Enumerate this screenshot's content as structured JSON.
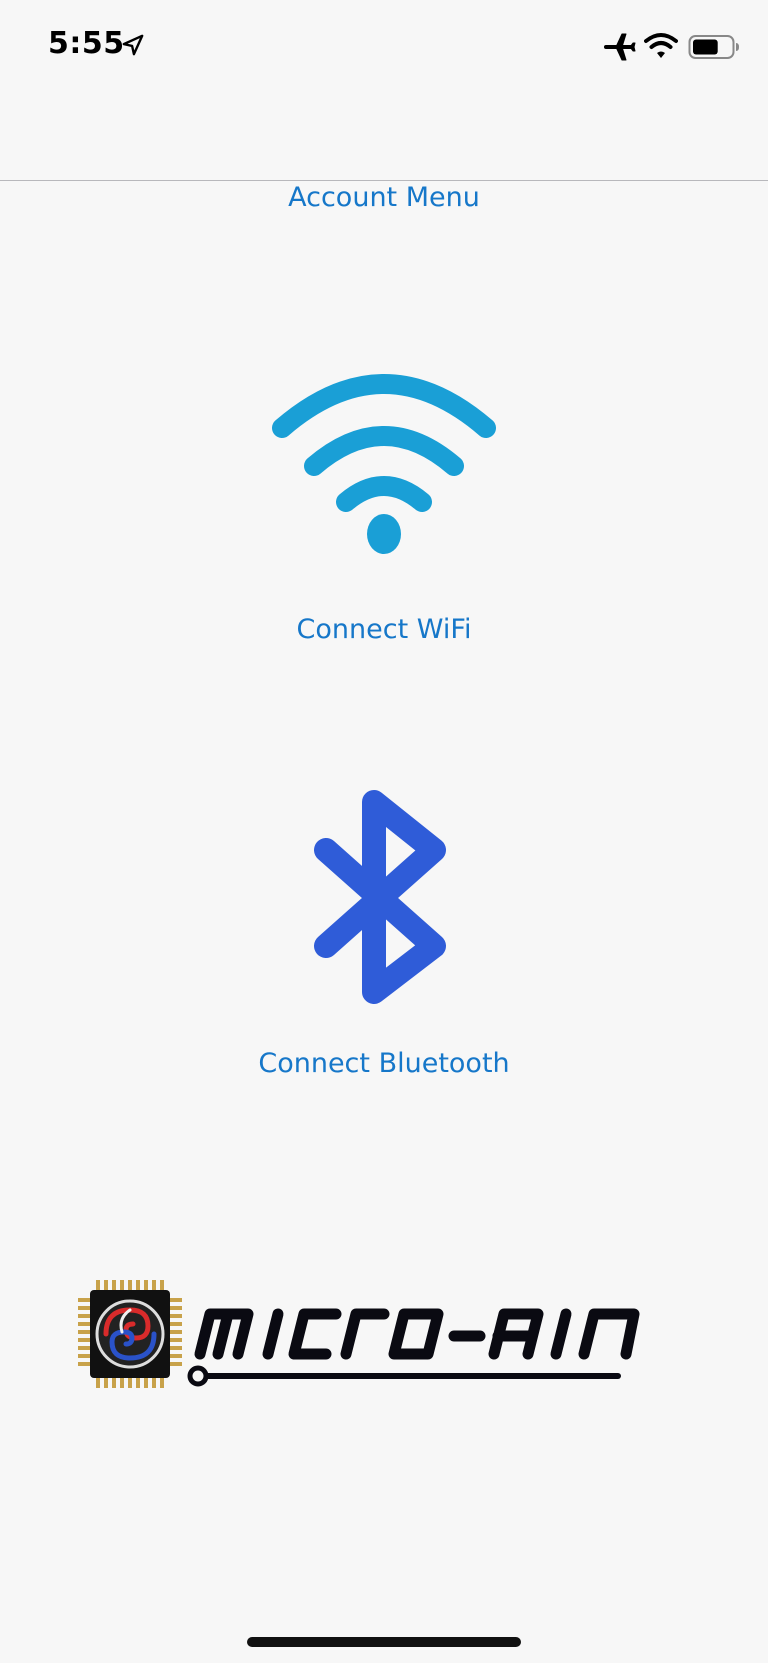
{
  "status_bar": {
    "time": "5:55",
    "icons": {
      "location": "location-arrow-icon",
      "airplane": "airplane-mode-icon",
      "wifi": "wifi-signal-icon",
      "battery": "battery-icon"
    },
    "battery_level": 0.65
  },
  "main": {
    "account_menu_label": "Account Menu",
    "wifi": {
      "label": "Connect WiFi",
      "icon": "wifi-icon",
      "color": "#1a9fd6"
    },
    "bluetooth": {
      "label": "Connect Bluetooth",
      "icon": "bluetooth-icon",
      "color": "#2f5cd8"
    },
    "link_color": "#1677c9"
  },
  "logo": {
    "text": "micro-air",
    "icon": "micro-air-logo"
  }
}
